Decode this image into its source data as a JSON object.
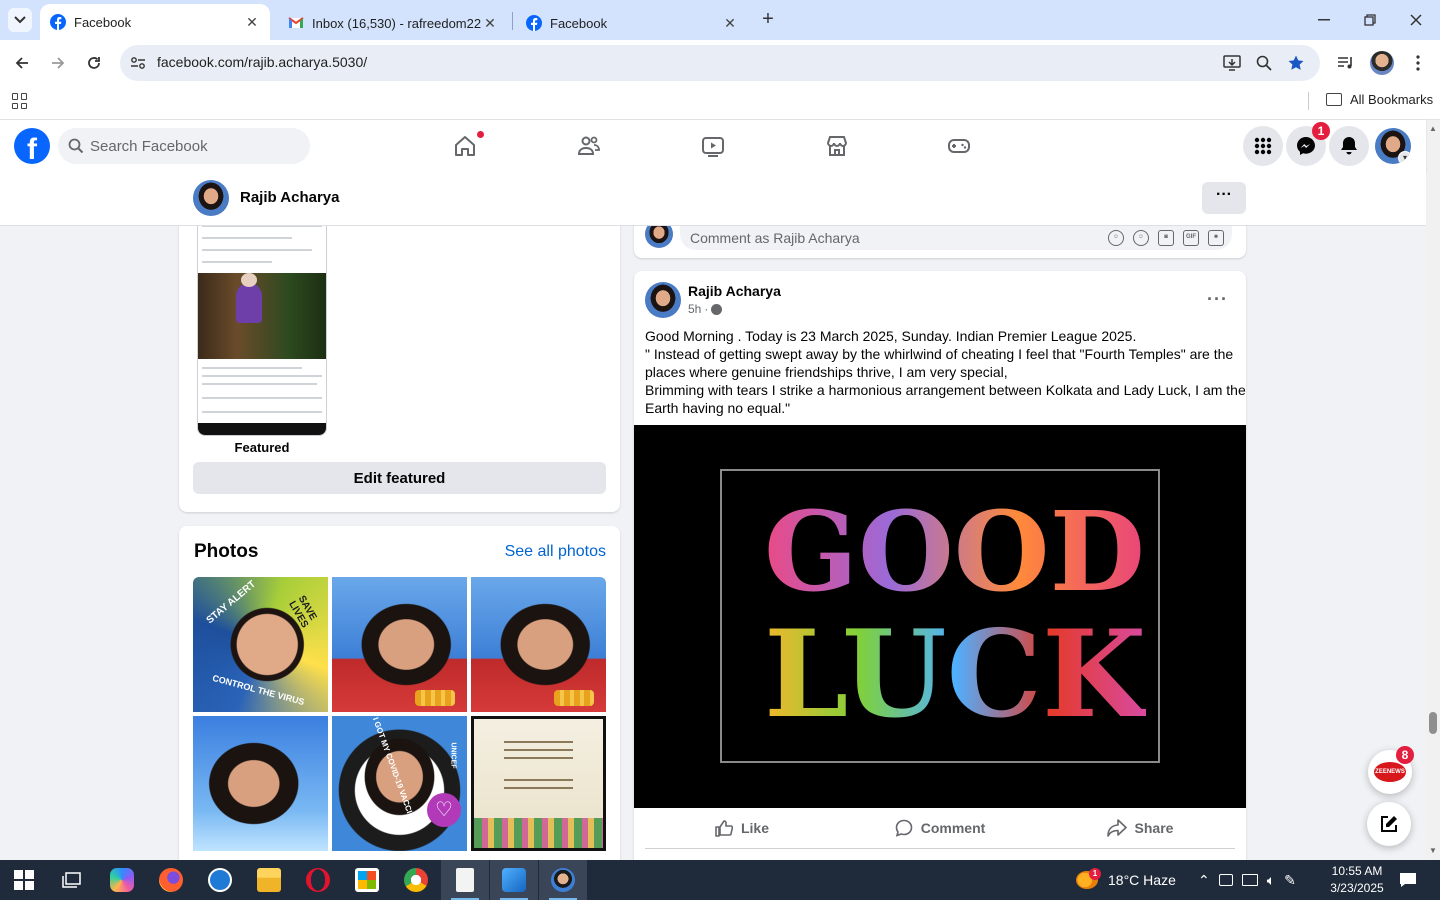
{
  "browser": {
    "tabs": [
      {
        "title": "Facebook",
        "active": true
      },
      {
        "title": "Inbox (16,530) - rafreedom22@",
        "active": false
      },
      {
        "title": "Facebook",
        "active": false
      }
    ],
    "url": "facebook.com/rajib.acharya.5030/",
    "bookmarks": {
      "all_label": "All Bookmarks"
    }
  },
  "facebook": {
    "search_placeholder": "Search Facebook",
    "messenger_badge": "1",
    "profile_name": "Rajib Acharya",
    "featured_label": "Featured",
    "edit_featured_label": "Edit featured",
    "photos_title": "Photos",
    "see_all_photos": "See all photos",
    "photo_texts": {
      "stay_alert": "STAY ALERT",
      "save_lives": "SAVE LIVES",
      "control_virus": "CONTROL THE VIRUS",
      "vaccine": "I GOT MY COVID-19 VACCINE",
      "unicef": "UNICEF"
    },
    "comment_placeholder": "Comment as Rajib Acharya",
    "comment_icons": [
      "avatar",
      "emoji",
      "camera",
      "GIF",
      "sticker"
    ],
    "post": {
      "author": "Rajib Acharya",
      "time": "5h",
      "text_lines": [
        "Good Morning . Today is 23 March 2025, Sunday.  Indian Premier League 2025.",
        "\" Instead of getting swept away by the whirlwind of cheating I feel that \"Fourth Temples\" are the",
        "places where genuine friendships thrive, I am very special,",
        "Brimming with tears I strike a harmonious arrangement between Kolkata and Lady Luck, I am the",
        "Earth having no equal.\""
      ],
      "image_word_1": "GOOD",
      "image_word_2": "LUCK",
      "actions": {
        "like": "Like",
        "comment": "Comment",
        "share": "Share"
      }
    },
    "notification_badge": "8",
    "zee_label": "ZEENEWS"
  },
  "taskbar": {
    "weather": "18°C  Haze",
    "weather_badge": "1",
    "time": "10:55 AM",
    "date": "3/23/2025"
  },
  "colors": {
    "fb_blue": "#0866ff",
    "badge_red": "#e41e3f",
    "link": "#0064d1",
    "taskbar": "#1f2a3a"
  }
}
